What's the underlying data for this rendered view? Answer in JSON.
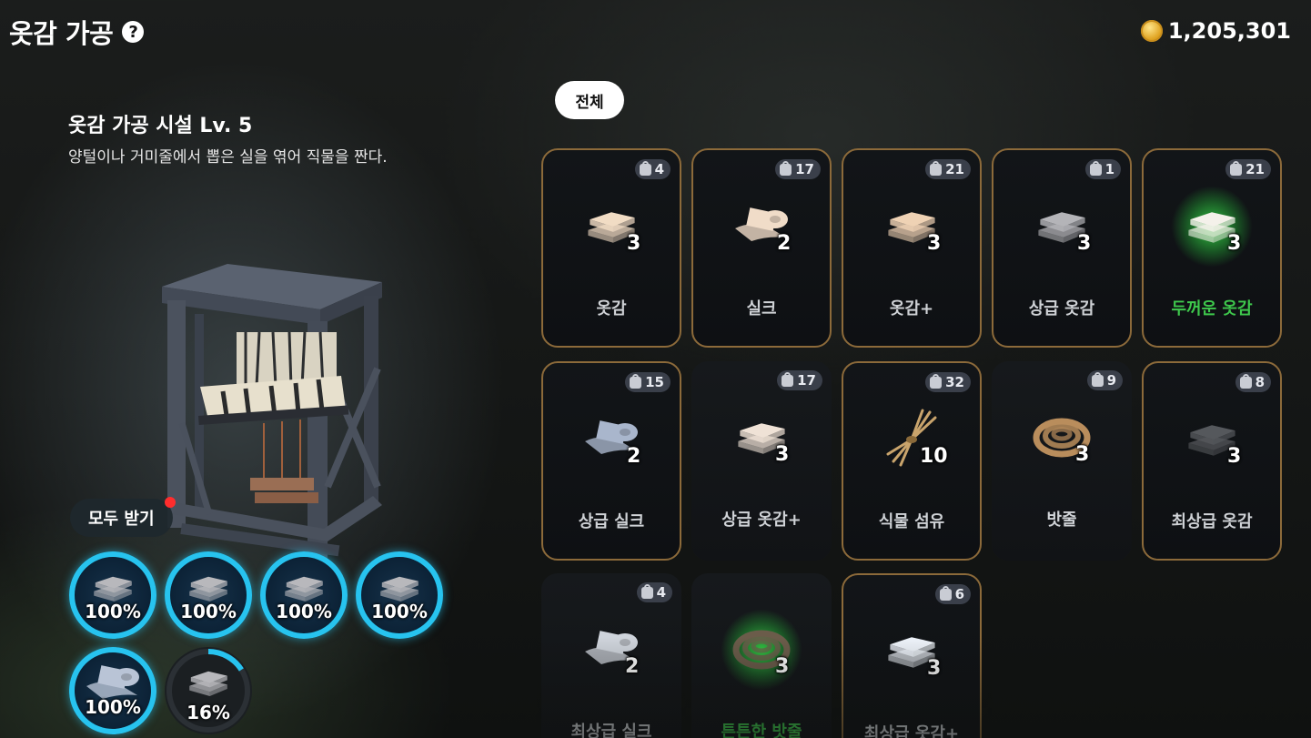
{
  "header": {
    "title": "옷감 가공",
    "help_icon": "help-icon"
  },
  "currency": {
    "icon": "gold-coin-icon",
    "amount": "1,205,301"
  },
  "facility": {
    "title": "옷감 가공 시설 Lv. 5",
    "description": "양털이나 거미줄에서 뽑은 실을 엮어 직물을 짠다."
  },
  "collect_all": {
    "label": "모두 받기",
    "has_notification": true
  },
  "production_slots": [
    {
      "item": "cloth",
      "percent": "100%",
      "state": "full"
    },
    {
      "item": "cloth",
      "percent": "100%",
      "state": "full"
    },
    {
      "item": "cloth",
      "percent": "100%",
      "state": "full"
    },
    {
      "item": "cloth",
      "percent": "100%",
      "state": "full"
    },
    {
      "item": "silk",
      "percent": "100%",
      "state": "full"
    },
    {
      "item": "cloth",
      "percent": "16%",
      "state": "partial",
      "progress": 0.16
    }
  ],
  "filter": {
    "label": "전체"
  },
  "items": [
    {
      "name": "옷감",
      "stock": "4",
      "qty": "3",
      "icon": "cloth-stack-icon",
      "color": "#f1dcc4",
      "green": false,
      "bordered": true
    },
    {
      "name": "실크",
      "stock": "17",
      "qty": "2",
      "icon": "silk-roll-icon",
      "color": "#f0dcc8",
      "green": false,
      "bordered": true
    },
    {
      "name": "옷감+",
      "stock": "21",
      "qty": "3",
      "icon": "cloth-stack-icon",
      "color": "#efd2b4",
      "green": false,
      "bordered": true
    },
    {
      "name": "상급 옷감",
      "stock": "1",
      "qty": "3",
      "icon": "cloth-stack-icon",
      "color": "#b4b4b8",
      "green": false,
      "bordered": true
    },
    {
      "name": "두꺼운 옷감",
      "stock": "21",
      "qty": "3",
      "icon": "cloth-stack-icon",
      "color": "#f4f1ea",
      "green": true,
      "bordered": true
    },
    {
      "name": "상급 실크",
      "stock": "15",
      "qty": "2",
      "icon": "silk-roll-icon",
      "color": "#a9b6cc",
      "green": false,
      "bordered": true
    },
    {
      "name": "상급 옷감+",
      "stock": "17",
      "qty": "3",
      "icon": "cloth-stack-icon",
      "color": "#efe2d6",
      "green": false,
      "bordered": false
    },
    {
      "name": "식물 섬유",
      "stock": "32",
      "qty": "10",
      "icon": "plant-fiber-icon",
      "color": "#c9a46c",
      "green": false,
      "bordered": true
    },
    {
      "name": "밧줄",
      "stock": "9",
      "qty": "3",
      "icon": "rope-coil-icon",
      "color": "#b98d5c",
      "green": false,
      "bordered": false
    },
    {
      "name": "최상급 옷감",
      "stock": "8",
      "qty": "3",
      "icon": "cloth-stack-icon",
      "color": "#55585c",
      "green": false,
      "bordered": true
    },
    {
      "name": "최상급 실크",
      "stock": "4",
      "qty": "2",
      "icon": "silk-roll-icon",
      "color": "#cfd4dc",
      "green": false,
      "bordered": false
    },
    {
      "name": "튼튼한 밧줄",
      "stock": "",
      "qty": "3",
      "icon": "rope-coil-icon",
      "color": "#6b5c4a",
      "green": true,
      "bordered": false
    },
    {
      "name": "최상급 옷감+",
      "stock": "6",
      "qty": "3",
      "icon": "cloth-stack-icon",
      "color": "#eef3fa",
      "green": false,
      "bordered": true
    }
  ]
}
